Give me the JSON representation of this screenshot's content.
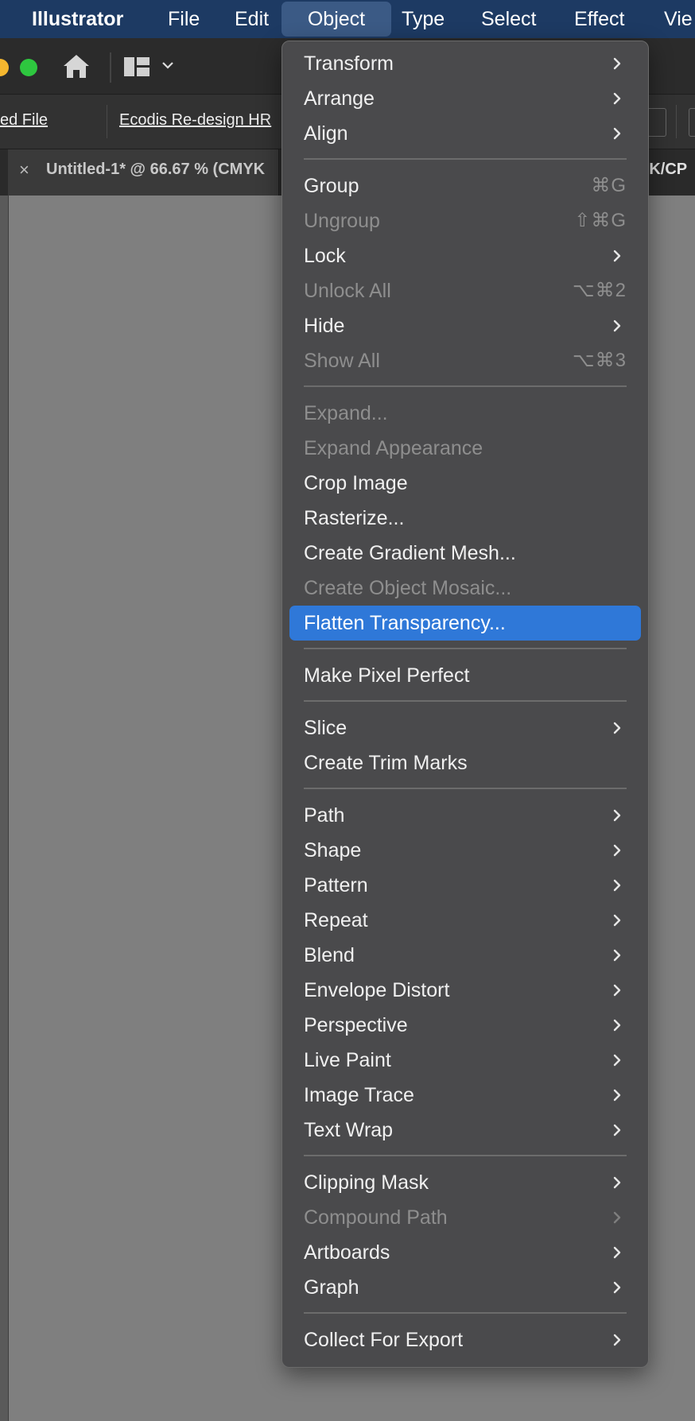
{
  "menubar": {
    "app": "Illustrator",
    "items": [
      "File",
      "Edit",
      "Object",
      "Type",
      "Select",
      "Effect",
      "Vie"
    ],
    "active": "Object"
  },
  "toolbar": {
    "home_icon": "home-icon",
    "workspace_icon": "workspace-switcher-icon"
  },
  "filebar": {
    "link1": "ed File",
    "link2": "Ecodis Re-design HR"
  },
  "tabbar": {
    "close": "×",
    "title": "Untitled-1* @ 66.67 % (CMYK",
    "right_fragment": "YK/CP"
  },
  "menu": {
    "items": [
      {
        "label": "Transform",
        "submenu": true
      },
      {
        "label": "Arrange",
        "submenu": true
      },
      {
        "label": "Align",
        "submenu": true
      },
      {
        "label": "Group",
        "shortcut": "⌘G"
      },
      {
        "label": "Ungroup",
        "shortcut": "⇧⌘G",
        "disabled": true
      },
      {
        "label": "Lock",
        "submenu": true
      },
      {
        "label": "Unlock All",
        "shortcut": "⌥⌘2",
        "disabled": true
      },
      {
        "label": "Hide",
        "submenu": true
      },
      {
        "label": "Show All",
        "shortcut": "⌥⌘3",
        "disabled": true
      },
      {
        "label": "Expand...",
        "disabled": true
      },
      {
        "label": "Expand Appearance",
        "disabled": true
      },
      {
        "label": "Crop Image"
      },
      {
        "label": "Rasterize..."
      },
      {
        "label": "Create Gradient Mesh..."
      },
      {
        "label": "Create Object Mosaic...",
        "disabled": true
      },
      {
        "label": "Flatten Transparency...",
        "highlighted": true
      },
      {
        "label": "Make Pixel Perfect"
      },
      {
        "label": "Slice",
        "submenu": true
      },
      {
        "label": "Create Trim Marks"
      },
      {
        "label": "Path",
        "submenu": true
      },
      {
        "label": "Shape",
        "submenu": true
      },
      {
        "label": "Pattern",
        "submenu": true
      },
      {
        "label": "Repeat",
        "submenu": true
      },
      {
        "label": "Blend",
        "submenu": true
      },
      {
        "label": "Envelope Distort",
        "submenu": true
      },
      {
        "label": "Perspective",
        "submenu": true
      },
      {
        "label": "Live Paint",
        "submenu": true
      },
      {
        "label": "Image Trace",
        "submenu": true
      },
      {
        "label": "Text Wrap",
        "submenu": true
      },
      {
        "label": "Clipping Mask",
        "submenu": true
      },
      {
        "label": "Compound Path",
        "submenu": true,
        "disabled": true
      },
      {
        "label": "Artboards",
        "submenu": true
      },
      {
        "label": "Graph",
        "submenu": true
      },
      {
        "label": "Collect For Export",
        "submenu": true
      }
    ]
  },
  "colors": {
    "menubar_bg": "#1d3a63",
    "menu_bg": "#4a4a4c",
    "highlight": "#2f78d8",
    "disabled_text": "#8e8e8e"
  }
}
